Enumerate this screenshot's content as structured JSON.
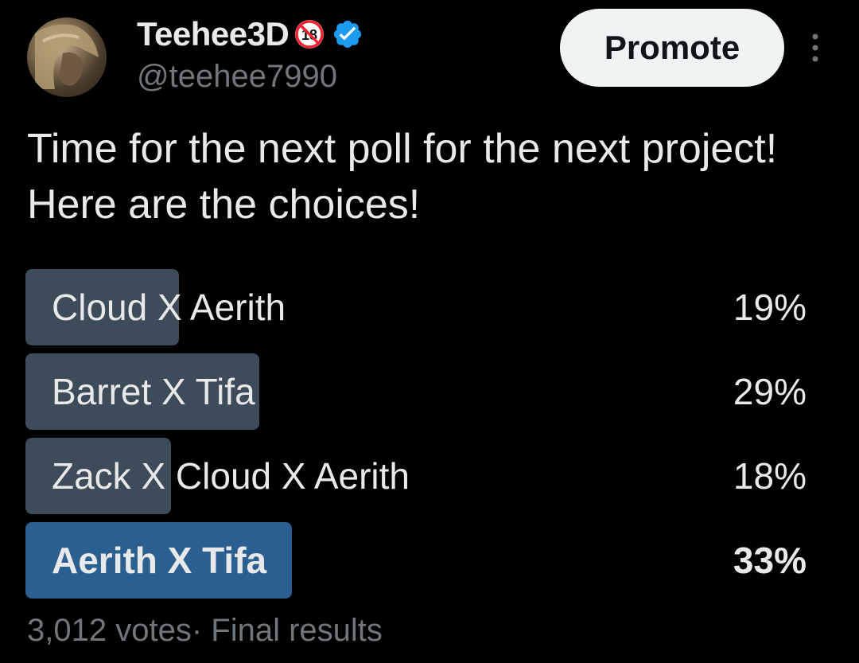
{
  "author": {
    "display_name": "Teehee3D",
    "handle": "@teehee7990",
    "badge_icon": "adults-only-18-icon",
    "verified_icon": "verified-badge-icon",
    "verified_color": "#1d9bf0",
    "badge_color": "#f4212e"
  },
  "actions": {
    "promote_label": "Promote",
    "more_icon": "more-vertical-icon"
  },
  "tweet": {
    "text": "Time for the next poll for the next project! Here are the choices!"
  },
  "poll": {
    "options": [
      {
        "label": "Cloud X Aerith",
        "percent_label": "19%",
        "percent": 19,
        "winner": false
      },
      {
        "label": "Barret X Tifa",
        "percent_label": "29%",
        "percent": 29,
        "winner": false
      },
      {
        "label": "Zack X Cloud X Aerith",
        "percent_label": "18%",
        "percent": 18,
        "winner": false
      },
      {
        "label": "Aerith X Tifa",
        "percent_label": "33%",
        "percent": 33,
        "winner": true
      }
    ],
    "votes_label": "3,012 votes",
    "status_label": "Final results",
    "bar_color": "#3e4c5a",
    "winner_bar_color": "#2b5f8f"
  }
}
